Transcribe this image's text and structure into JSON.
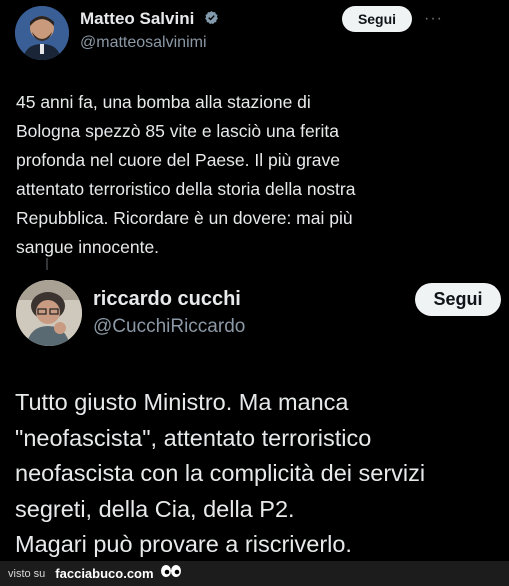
{
  "tweet1": {
    "name": "Matteo Salvini",
    "handle": "@matteosalvinimi",
    "follow_label": "Segui",
    "more_label": "···",
    "text": "45 anni fa, una bomba alla stazione di\nBologna spezzò 85 vite e lasciò una ferita\nprofonda nel cuore del Paese. Il più grave\nattentato terroristico della storia della nostra\nRepubblica. Ricordare è un dovere: mai più\nsangue innocente."
  },
  "tweet2": {
    "name": "riccardo cucchi",
    "handle": "@CucchiRiccardo",
    "follow_label": "Segui",
    "text": "Tutto giusto Ministro. Ma manca\n\"neofascista\", attentato terroristico\nneofascista con la complicità dei servizi\nsegreti, della Cia, della P2.\nMagari può provare a riscriverlo."
  },
  "footer": {
    "prefix": "visto su",
    "brand": "facciabuco.com"
  },
  "colors": {
    "background": "#000000",
    "text": "#e7e9ea",
    "secondary": "#8b98a5",
    "verified": "#829aab",
    "button": "#eff3f4"
  }
}
